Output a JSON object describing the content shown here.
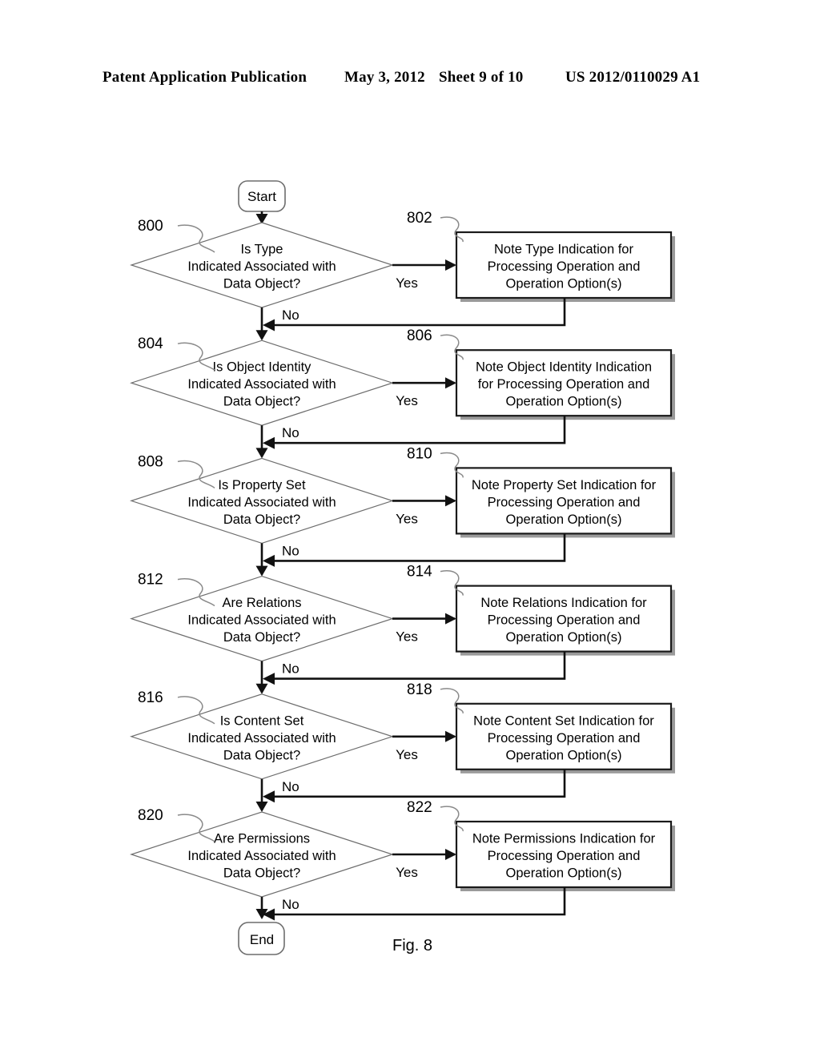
{
  "header": {
    "publication": "Patent Application Publication",
    "date": "May 3, 2012",
    "sheet": "Sheet 9 of 10",
    "patent_number": "US 2012/0110029 A1"
  },
  "figure": {
    "caption": "Fig. 8",
    "start_label": "Start",
    "end_label": "End",
    "yes_label": "Yes",
    "no_label": "No",
    "rows": [
      {
        "decision_ref": "800",
        "decision_lines": [
          "Is Type",
          "Indicated Associated with",
          "Data Object?"
        ],
        "process_ref": "802",
        "process_lines": [
          "Note Type Indication for",
          "Processing Operation and",
          "Operation Option(s)"
        ]
      },
      {
        "decision_ref": "804",
        "decision_lines": [
          "Is Object Identity",
          "Indicated Associated with",
          "Data Object?"
        ],
        "process_ref": "806",
        "process_lines": [
          "Note Object Identity Indication",
          "for Processing Operation and",
          "Operation Option(s)"
        ]
      },
      {
        "decision_ref": "808",
        "decision_lines": [
          "Is Property Set",
          "Indicated Associated with",
          "Data Object?"
        ],
        "process_ref": "810",
        "process_lines": [
          "Note Property Set Indication for",
          "Processing Operation and",
          "Operation Option(s)"
        ]
      },
      {
        "decision_ref": "812",
        "decision_lines": [
          "Are Relations",
          "Indicated Associated with",
          "Data Object?"
        ],
        "process_ref": "814",
        "process_lines": [
          "Note Relations Indication for",
          "Processing Operation and",
          "Operation Option(s)"
        ]
      },
      {
        "decision_ref": "816",
        "decision_lines": [
          "Is Content Set",
          "Indicated Associated with",
          "Data Object?"
        ],
        "process_ref": "818",
        "process_lines": [
          "Note Content Set Indication for",
          "Processing Operation and",
          "Operation Option(s)"
        ]
      },
      {
        "decision_ref": "820",
        "decision_lines": [
          "Are Permissions",
          "Indicated Associated with",
          "Data Object?"
        ],
        "process_ref": "822",
        "process_lines": [
          "Note Permissions Indication for",
          "Processing Operation and",
          "Operation Option(s)"
        ]
      }
    ]
  },
  "colors": {
    "ink": "#000000",
    "line": "#111111",
    "faint": "#8a8a8a",
    "background": "#ffffff"
  }
}
